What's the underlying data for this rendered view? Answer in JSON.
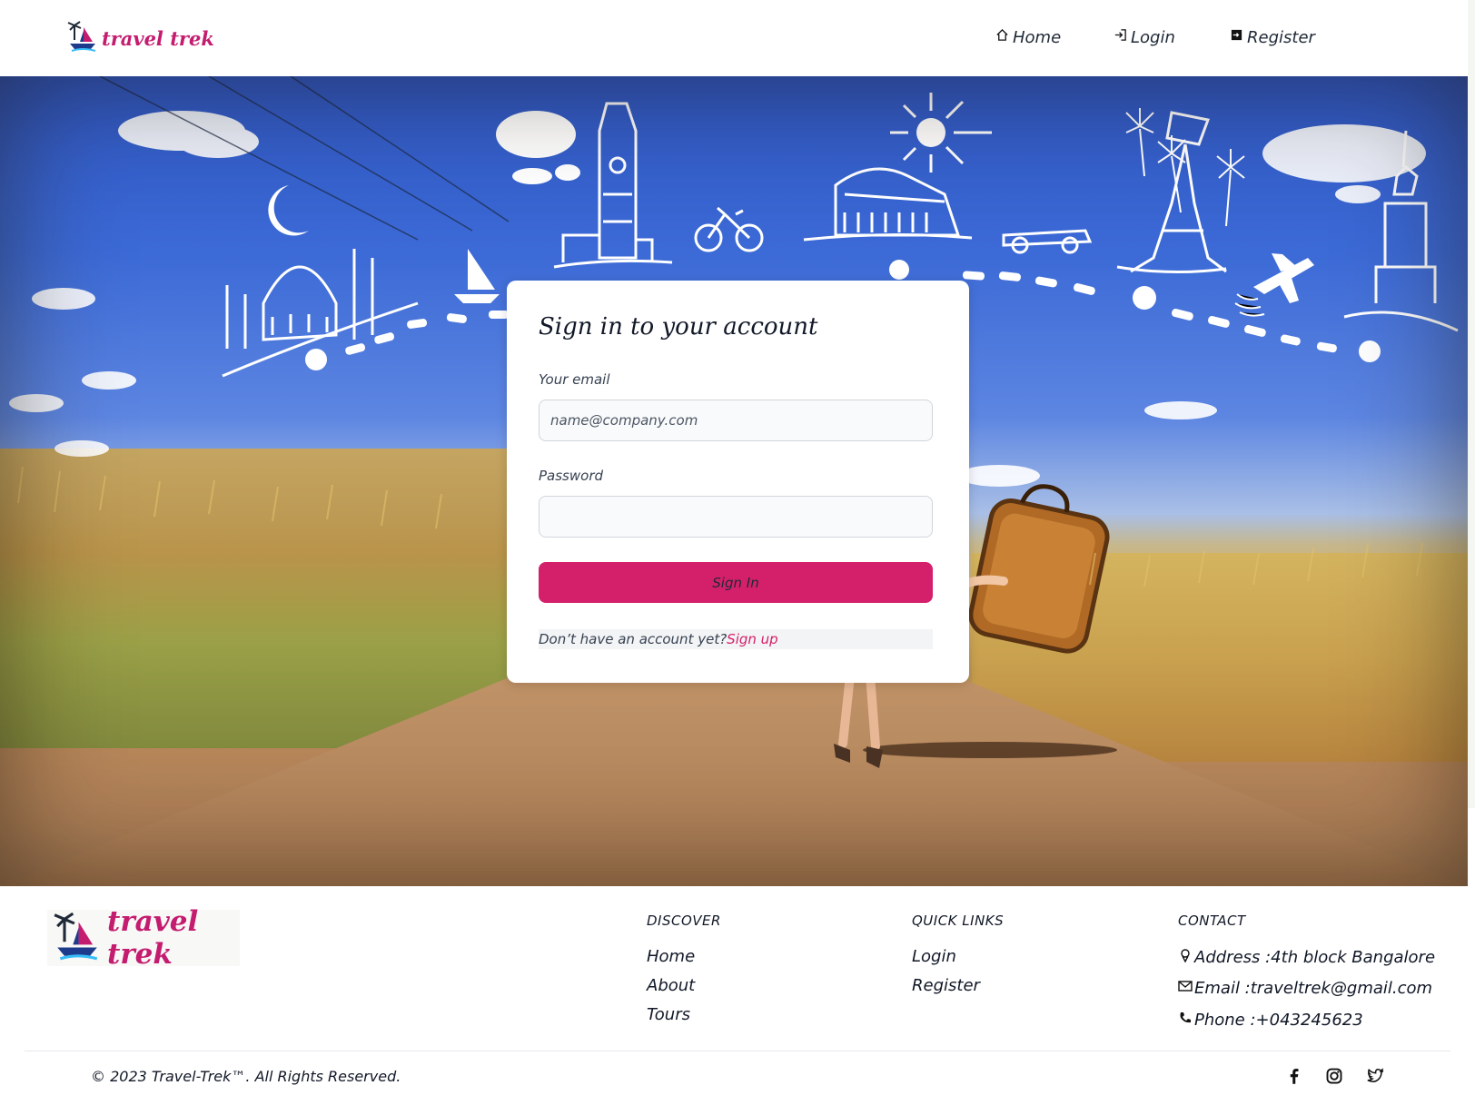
{
  "header": {
    "brand": "travel trek",
    "nav": {
      "home": "Home",
      "login": "Login",
      "register": "Register"
    }
  },
  "login_card": {
    "title": "Sign in to your account",
    "email_label": "Your email",
    "email_placeholder": "name@company.com",
    "password_label": "Password",
    "signin_button": "Sign In",
    "no_account_text": "Don’t have an account yet?",
    "signup_link": "Sign up"
  },
  "footer": {
    "brand": "travel trek",
    "discover": {
      "title": "DISCOVER",
      "links": [
        "Home",
        "About",
        "Tours"
      ]
    },
    "quick_links": {
      "title": "QUICK LINKS",
      "links": [
        "Login",
        "Register"
      ]
    },
    "contact": {
      "title": "CONTACT",
      "address": "Address :4th block Bangalore",
      "email": "Email :traveltrek@gmail.com",
      "phone": "Phone :+043245623"
    },
    "copyright": "© 2023 Travel-Trek™. All Rights Reserved."
  },
  "colors": {
    "brand": "#c41c6f",
    "button": "#d4206a",
    "link": "#d4206a"
  },
  "icons": [
    "home-icon",
    "login-icon",
    "register-icon",
    "map-pin-icon",
    "mail-icon",
    "phone-icon",
    "facebook-icon",
    "instagram-icon",
    "twitter-icon"
  ]
}
